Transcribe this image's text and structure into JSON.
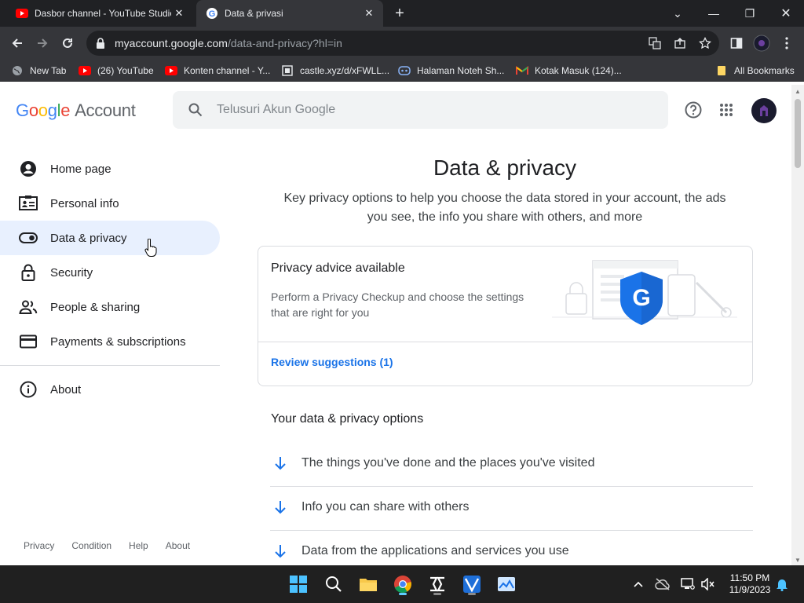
{
  "browser": {
    "tabs": [
      {
        "title": "Dasbor channel - YouTube Studio",
        "favicon": "youtube-icon"
      },
      {
        "title": "Data & privasi",
        "favicon": "google-g-icon"
      }
    ],
    "address": {
      "host": "myaccount.google.com",
      "path": "/data-and-privacy?hl=in"
    },
    "bookmarks": [
      {
        "label": "New Tab",
        "icon": "globe-icon"
      },
      {
        "label": "(26) YouTube",
        "icon": "youtube-icon"
      },
      {
        "label": "Konten channel - Y...",
        "icon": "youtube-icon"
      },
      {
        "label": "castle.xyz/d/xFWLL...",
        "icon": "castle-icon"
      },
      {
        "label": "Halaman Noteh Sh...",
        "icon": "discord-icon"
      },
      {
        "label": "Kotak Masuk (124)...",
        "icon": "gmail-icon"
      }
    ],
    "all_bookmarks": "All Bookmarks"
  },
  "header": {
    "logo_google": "Google",
    "logo_account": "Account",
    "search_placeholder": "Telusuri Akun Google"
  },
  "sidebar": {
    "items": [
      {
        "label": "Home page",
        "icon": "account-circle-icon"
      },
      {
        "label": "Personal info",
        "icon": "id-card-icon"
      },
      {
        "label": "Data & privacy",
        "icon": "toggle-icon",
        "active": true
      },
      {
        "label": "Security",
        "icon": "lock-icon"
      },
      {
        "label": "People & sharing",
        "icon": "people-icon"
      },
      {
        "label": "Payments & subscriptions",
        "icon": "credit-card-icon"
      }
    ],
    "about": "About"
  },
  "footer": {
    "links": [
      "Privacy",
      "Condition",
      "Help",
      "About"
    ]
  },
  "main": {
    "title": "Data & privacy",
    "subtitle": "Key privacy options to help you choose the data stored in your account, the ads you see, the info you share with others, and more",
    "card": {
      "title": "Privacy advice available",
      "description": "Perform a Privacy Checkup and choose the settings that are right for you",
      "link": "Review suggestions (1)"
    },
    "section_title": "Your data & privacy options",
    "options": [
      "The things you've done and the places you've visited",
      "Info you can share with others",
      "Data from the applications and services you use"
    ]
  },
  "taskbar": {
    "time": "11:50 PM",
    "date": "11/9/2023"
  },
  "colors": {
    "accent": "#1a73e8",
    "active_nav": "#e8f0fe",
    "chrome_dark": "#202124"
  }
}
